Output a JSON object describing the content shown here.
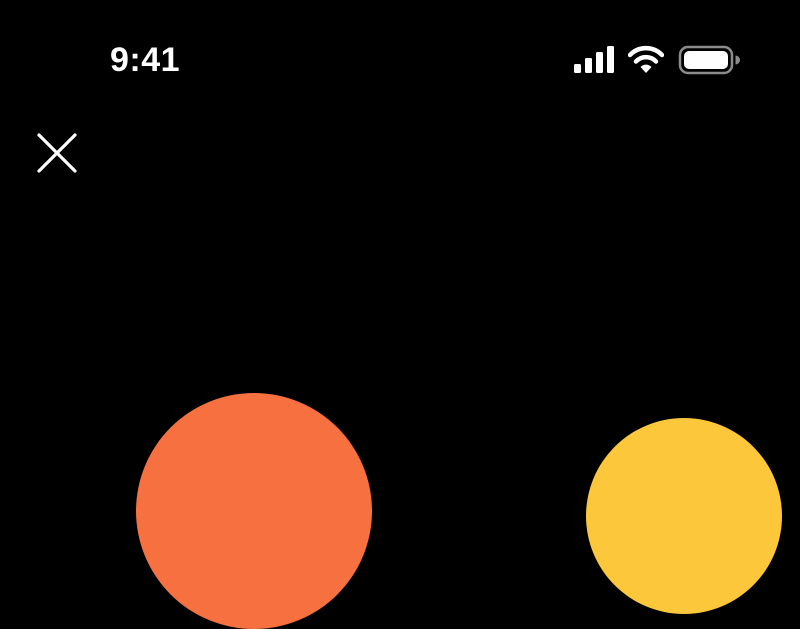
{
  "status_bar": {
    "time": "9:41",
    "signal_icon": "cellular-signal-icon",
    "wifi_icon": "wifi-icon",
    "battery_icon": "battery-icon"
  },
  "header": {
    "close_icon": "close-icon"
  },
  "colors": {
    "background": "#000000",
    "foreground": "#ffffff",
    "orange": "#f77040",
    "yellow": "#fdc73c"
  }
}
